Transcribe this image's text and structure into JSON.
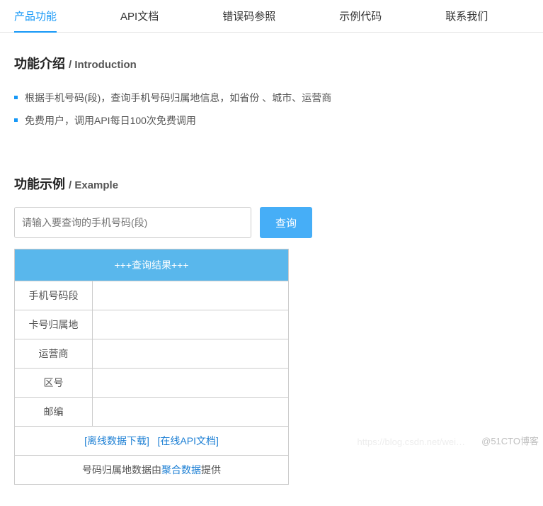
{
  "tabs": [
    {
      "label": "产品功能",
      "active": true
    },
    {
      "label": "API文档"
    },
    {
      "label": "错误码参照"
    },
    {
      "label": "示例代码"
    },
    {
      "label": "联系我们"
    }
  ],
  "intro": {
    "heading_main": "功能介绍 ",
    "heading_sub": "/ Introduction",
    "items": [
      "根据手机号码(段)，查询手机号码归属地信息，如省份 、城市、运营商",
      "免费用户，调用API每日100次免费调用"
    ]
  },
  "example": {
    "heading_main": "功能示例 ",
    "heading_sub": "/ Example",
    "placeholder": "请输入要查询的手机号码(段)",
    "search_btn": "查询",
    "result_header": "+++查询结果+++",
    "rows": [
      {
        "label": "手机号码段"
      },
      {
        "label": "卡号归属地"
      },
      {
        "label": "运营商"
      },
      {
        "label": "区号"
      },
      {
        "label": "邮编"
      }
    ],
    "footer_links": {
      "offline": "[离线数据下载]",
      "online": "[在线API文档]"
    },
    "footer_text_pre": "号码归属地数据由",
    "footer_text_link": "聚合数据",
    "footer_text_post": "提供"
  },
  "watermark": {
    "left": "https://blog.csdn.net/wei…",
    "right": "@51CTO博客"
  }
}
